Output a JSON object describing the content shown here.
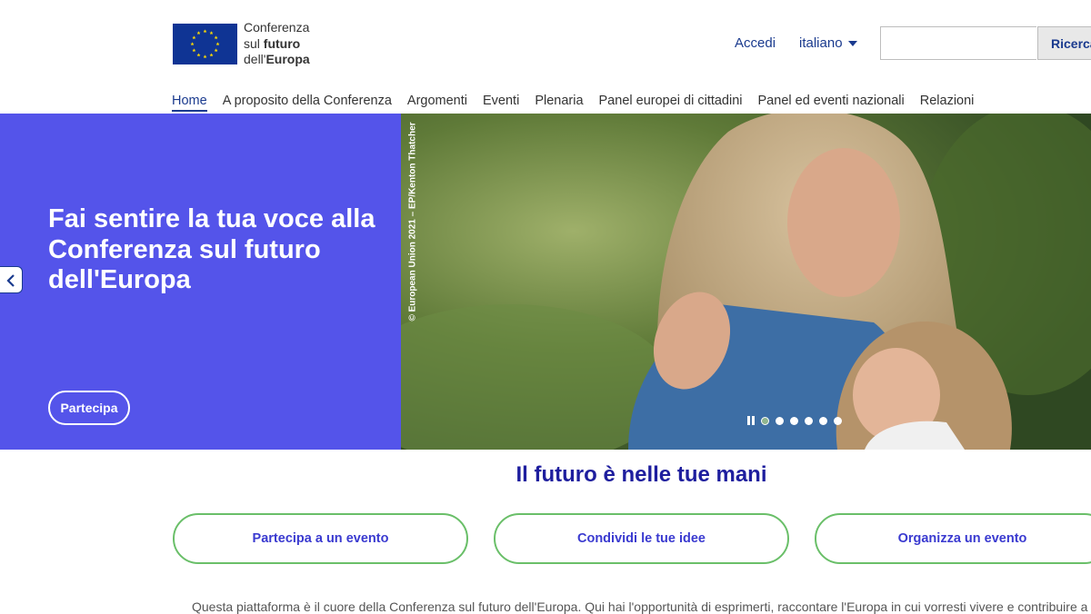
{
  "header": {
    "logo_lines": [
      "Conferenza",
      "sul ",
      "futuro",
      "dell'",
      "Europa"
    ],
    "login_label": "Accedi",
    "language": "italiano",
    "search_placeholder": "",
    "search_button": "Ricerca"
  },
  "nav": {
    "items": [
      "Home",
      "A proposito della Conferenza",
      "Argomenti",
      "Eventi",
      "Plenaria",
      "Panel europei di cittadini",
      "Panel ed eventi nazionali",
      "Relazioni"
    ],
    "active_index": 0
  },
  "hero": {
    "title": "Fai sentire la tua voce alla Conferenza sul futuro dell'Europa",
    "join_button": "Partecipa",
    "photo_credit": "© European Union 2021 – EP/Kenton Thatcher",
    "slide_count": 6,
    "active_slide": 1
  },
  "main": {
    "section_title": "Il futuro è nelle tue mani",
    "cta_buttons": [
      "Partecipa a un evento",
      "Condividi le tue idee",
      "Organizza un evento"
    ],
    "intro": "Questa piattaforma è il cuore della Conferenza sul futuro dell'Europa. Qui hai l'opportunità di esprimerti, raccontare l'Europa in cui vorresti vivere e contribuire a"
  },
  "colors": {
    "hero_panel": "#5454ea",
    "brand_blue": "#1a3a8e",
    "cta_border": "#6abf69",
    "title_blue": "#1e1e9e"
  }
}
